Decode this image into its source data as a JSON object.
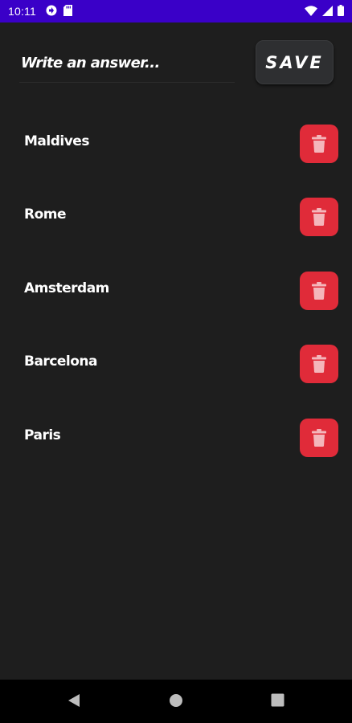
{
  "status_bar": {
    "time": "10:11",
    "icons": [
      "vpn-key-icon",
      "sd-card-icon",
      "wifi-icon",
      "signal-icon",
      "battery-icon"
    ]
  },
  "answer_input": {
    "placeholder": "Write an answer...",
    "value": ""
  },
  "save_button": {
    "label": "SAVE"
  },
  "answers": [
    {
      "label": "Maldives"
    },
    {
      "label": "Rome"
    },
    {
      "label": "Amsterdam"
    },
    {
      "label": "Barcelona"
    },
    {
      "label": "Paris"
    }
  ],
  "colors": {
    "status_bar": "#3a00c8",
    "background": "#1e1e1e",
    "delete_button": "#e02b39",
    "trash_icon": "#f4b6bb",
    "save_button": "#2e2f31",
    "nav_bar": "#000000"
  },
  "nav_bar": {
    "buttons": [
      "back-icon",
      "home-icon",
      "recents-icon"
    ]
  }
}
